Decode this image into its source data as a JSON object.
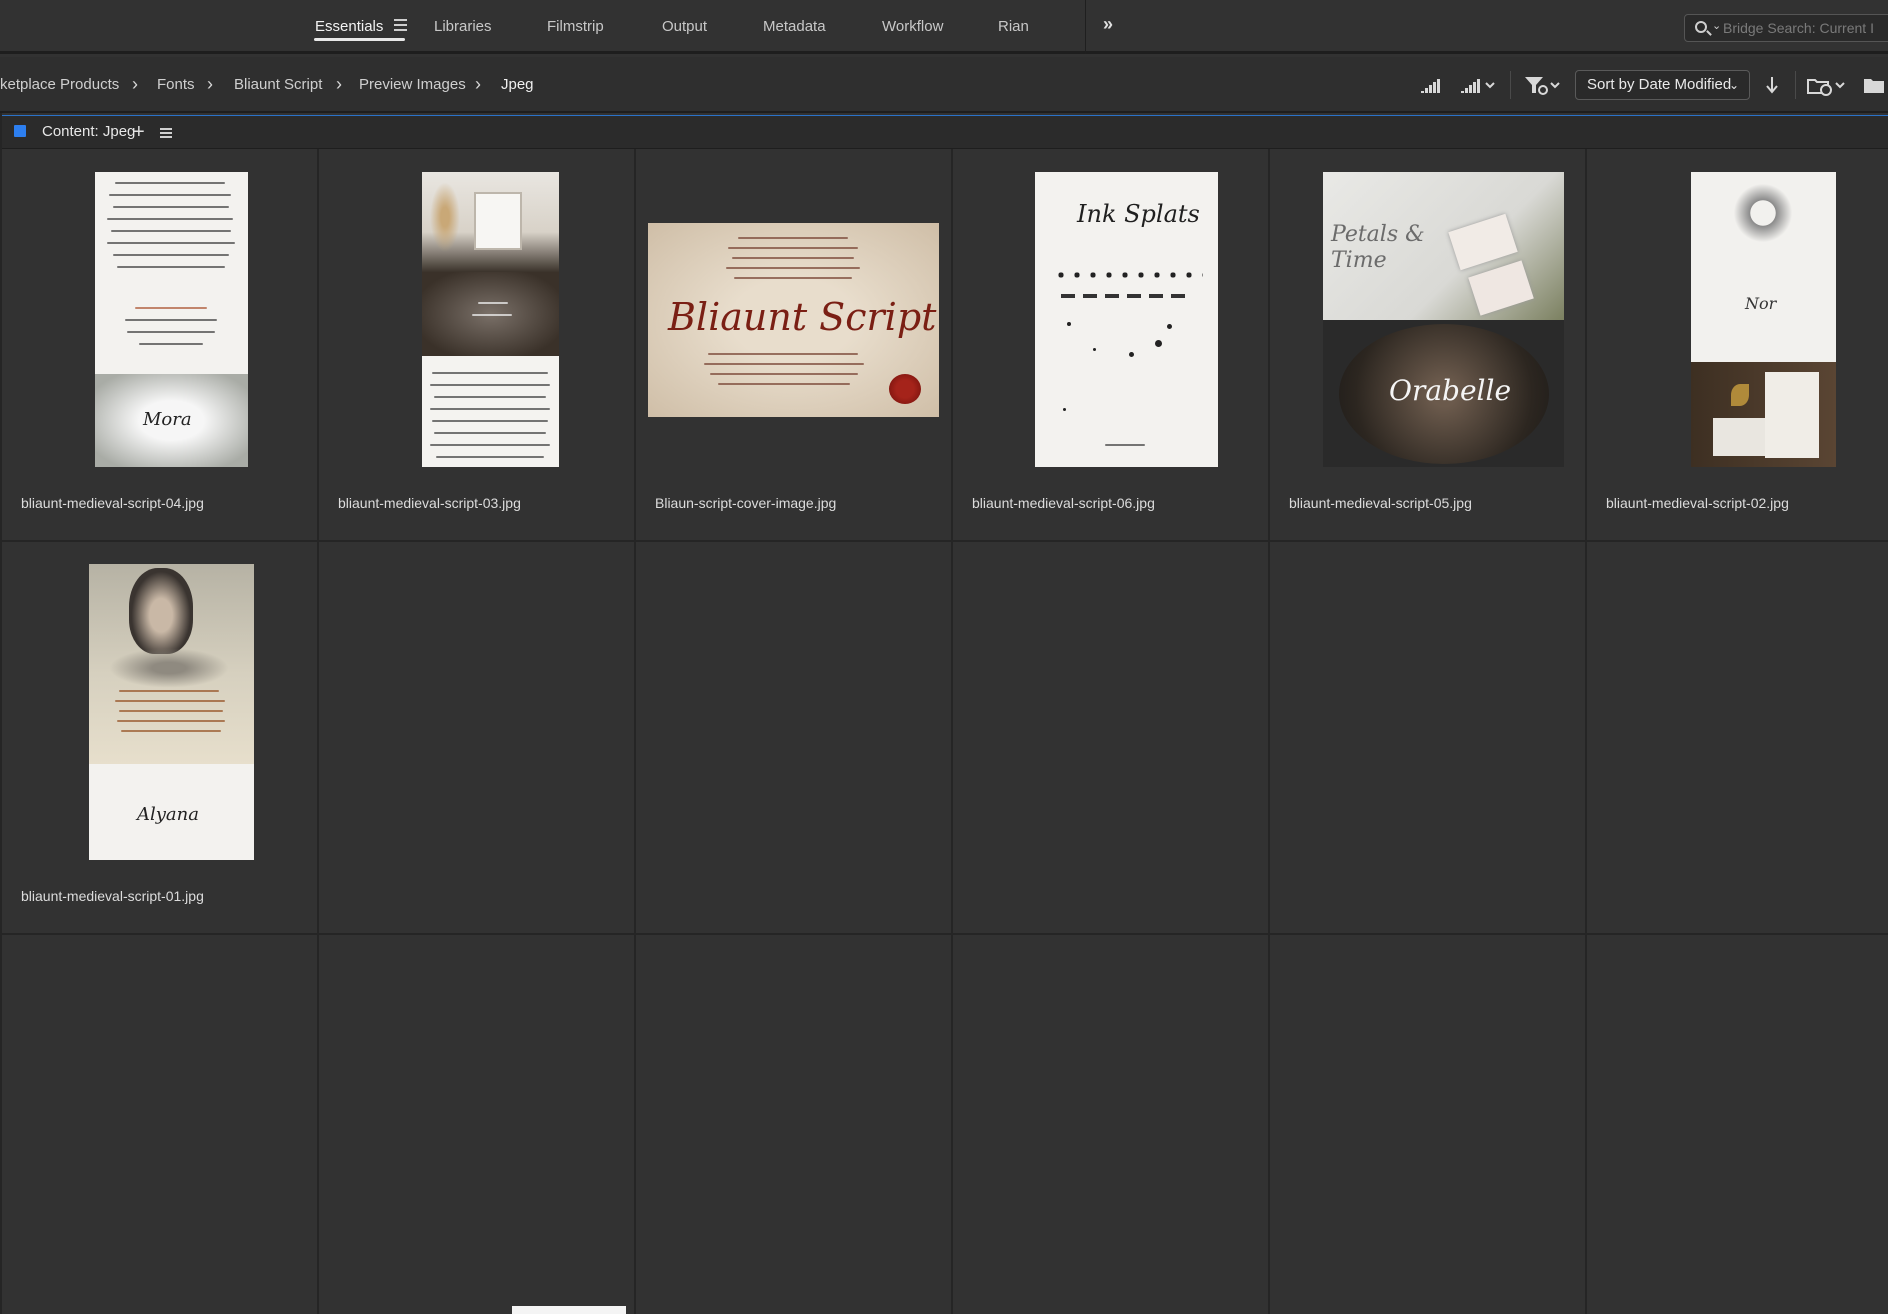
{
  "workspace_tabs": [
    {
      "label": "Essentials",
      "active": true
    },
    {
      "label": "Libraries"
    },
    {
      "label": "Filmstrip"
    },
    {
      "label": "Output"
    },
    {
      "label": "Metadata"
    },
    {
      "label": "Workflow"
    },
    {
      "label": "Rian"
    }
  ],
  "search": {
    "placeholder": "Bridge Search: Current I"
  },
  "breadcrumb": [
    "ketplace Products",
    "Fonts",
    "Bliaunt Script",
    "Preview Images",
    "Jpeg"
  ],
  "toolbar": {
    "sort_label": "Sort by Date Modified"
  },
  "content_panel": {
    "title": "Content: Jpeg"
  },
  "files": [
    {
      "name": "bliaunt-medieval-script-04.jpg",
      "thumb_word": "Mora"
    },
    {
      "name": "bliaunt-medieval-script-03.jpg",
      "thumb_word": ""
    },
    {
      "name": "Bliaun-script-cover-image.jpg",
      "thumb_word": "Bliaunt Script"
    },
    {
      "name": "bliaunt-medieval-script-06.jpg",
      "thumb_word": "Ink Splats"
    },
    {
      "name": "bliaunt-medieval-script-05.jpg",
      "thumb_word": "Orabelle",
      "thumb_word2": "Petals & Time"
    },
    {
      "name": "bliaunt-medieval-script-02.jpg",
      "thumb_word": "Nor"
    },
    {
      "name": "bliaunt-medieval-script-01.jpg",
      "thumb_word": "Alyana"
    }
  ],
  "colors": {
    "accent": "#2d7ff0",
    "background": "#323232",
    "grid_line": "#252525"
  }
}
